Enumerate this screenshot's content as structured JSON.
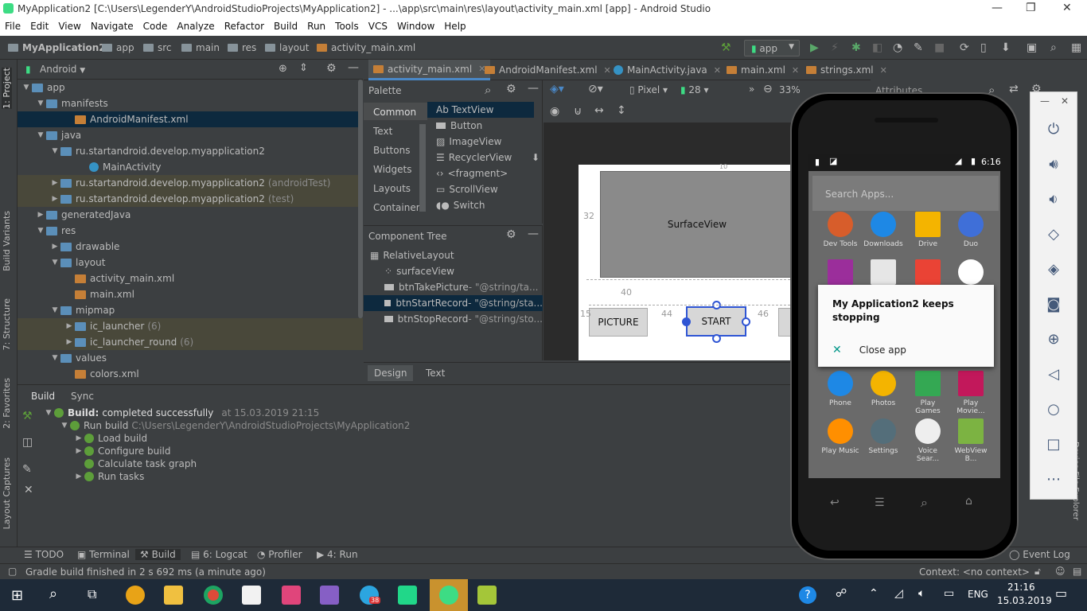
{
  "window": {
    "title": "MyApplication2 [C:\\Users\\LegenderY\\AndroidStudioProjects\\MyApplication2] - ...\\app\\src\\main\\res\\layout\\activity_main.xml [app] - Android Studio",
    "minimize": "—",
    "maximize": "❐",
    "close": "✕"
  },
  "menu": [
    "File",
    "Edit",
    "View",
    "Navigate",
    "Code",
    "Analyze",
    "Refactor",
    "Build",
    "Run",
    "Tools",
    "VCS",
    "Window",
    "Help"
  ],
  "breadcrumb": [
    "MyApplication2",
    "app",
    "src",
    "main",
    "res",
    "layout",
    "activity_main.xml"
  ],
  "run_config": "app",
  "project": {
    "view": "Android",
    "tree": [
      {
        "label": "app",
        "indent": 0,
        "arrow": "▼",
        "icon": "folder"
      },
      {
        "label": "manifests",
        "indent": 1,
        "arrow": "▼",
        "icon": "folder"
      },
      {
        "label": "AndroidManifest.xml",
        "indent": 3,
        "arrow": "",
        "icon": "xml",
        "selected": true
      },
      {
        "label": "java",
        "indent": 1,
        "arrow": "▼",
        "icon": "folder"
      },
      {
        "label": "ru.startandroid.develop.myapplication2",
        "indent": 2,
        "arrow": "▼",
        "icon": "folder"
      },
      {
        "label": "MainActivity",
        "indent": 4,
        "arrow": "",
        "icon": "class"
      },
      {
        "label": "ru.startandroid.develop.myapplication2",
        "suffix": "(androidTest)",
        "indent": 2,
        "arrow": "▶",
        "icon": "folder"
      },
      {
        "label": "ru.startandroid.develop.myapplication2",
        "suffix": "(test)",
        "indent": 2,
        "arrow": "▶",
        "icon": "folder"
      },
      {
        "label": "generatedJava",
        "indent": 1,
        "arrow": "▶",
        "icon": "folder"
      },
      {
        "label": "res",
        "indent": 1,
        "arrow": "▼",
        "icon": "folder"
      },
      {
        "label": "drawable",
        "indent": 2,
        "arrow": "▶",
        "icon": "folder"
      },
      {
        "label": "layout",
        "indent": 2,
        "arrow": "▼",
        "icon": "folder"
      },
      {
        "label": "activity_main.xml",
        "indent": 3,
        "arrow": "",
        "icon": "xml"
      },
      {
        "label": "main.xml",
        "indent": 3,
        "arrow": "",
        "icon": "xml"
      },
      {
        "label": "mipmap",
        "indent": 2,
        "arrow": "▼",
        "icon": "folder"
      },
      {
        "label": "ic_launcher",
        "suffix": "(6)",
        "indent": 3,
        "arrow": "▶",
        "icon": "folder"
      },
      {
        "label": "ic_launcher_round",
        "suffix": "(6)",
        "indent": 3,
        "arrow": "▶",
        "icon": "folder"
      },
      {
        "label": "values",
        "indent": 2,
        "arrow": "▼",
        "icon": "folder"
      },
      {
        "label": "colors.xml",
        "indent": 3,
        "arrow": "",
        "icon": "xml"
      }
    ]
  },
  "left_tabs": [
    "1: Project",
    "Build Variants",
    "7: Structure",
    "2: Favorites",
    "Layout Captures"
  ],
  "editor_tabs": [
    {
      "label": "activity_main.xml",
      "active": true
    },
    {
      "label": "AndroidManifest.xml"
    },
    {
      "label": "MainActivity.java"
    },
    {
      "label": "main.xml"
    },
    {
      "label": "strings.xml"
    }
  ],
  "palette": {
    "title": "Palette",
    "categories": [
      "Common",
      "Text",
      "Buttons",
      "Widgets",
      "Layouts",
      "Container"
    ],
    "items": [
      "Ab TextView",
      "Button",
      "ImageView",
      "RecyclerView",
      "<fragment>",
      "ScrollView",
      "Switch"
    ]
  },
  "component_tree": {
    "title": "Component Tree",
    "items": [
      {
        "label": "RelativeLayout",
        "indent": 0
      },
      {
        "label": "surfaceView",
        "indent": 1
      },
      {
        "label": "btnTakePicture",
        "suffix": "- \"@string/ta...",
        "indent": 1
      },
      {
        "label": "btnStartRecord",
        "suffix": "- \"@string/sta...",
        "indent": 1,
        "selected": true
      },
      {
        "label": "btnStopRecord",
        "suffix": "- \"@string/sto...",
        "indent": 1
      }
    ]
  },
  "design_toolbar": {
    "device": "Pixel",
    "api": "28",
    "zoom": "33%",
    "attributes": "Attributes"
  },
  "design": {
    "surface_label": "SurfaceView",
    "btn_picture": "PICTURE",
    "btn_start": "START",
    "dims": [
      "10",
      "32",
      "40",
      "44",
      "46",
      "15"
    ]
  },
  "design_tabs": [
    "Design",
    "Text"
  ],
  "build": {
    "tabs": [
      "Build",
      "Sync"
    ],
    "root_label": "Build:",
    "root_status": "completed successfully",
    "root_time": "at 15.03.2019 21:15",
    "run_build": "Run build",
    "run_build_path": "C:\\Users\\LegenderY\\AndroidStudioProjects\\MyApplication2",
    "steps": [
      "Load build",
      "Configure build",
      "Calculate task graph",
      "Run tasks"
    ]
  },
  "bottom_tabs": [
    "TODO",
    "Terminal",
    "Build",
    "6: Logcat",
    "Profiler",
    "4: Run"
  ],
  "event_log": "Event Log",
  "status": {
    "message": "Gradle build finished in 2 s 692 ms (a minute ago)",
    "context": "Context: <no context>"
  },
  "phone": {
    "time": "6:16",
    "search_placeholder": "Search Apps...",
    "apps_row1": [
      "Dev Tools",
      "Downloads",
      "Drive",
      "Duo"
    ],
    "apps_row3": [
      "Phone",
      "Photos",
      "Play Games",
      "Play Movie..."
    ],
    "apps_row4": [
      "Play Music",
      "Settings",
      "Voice Sear...",
      "WebView B..."
    ],
    "dialog_title": "My Application2 keeps stopping",
    "dialog_action": "Close app"
  },
  "taskbar": {
    "lang": "ENG",
    "time": "21:16",
    "date": "15.03.2019",
    "badge": "38"
  }
}
